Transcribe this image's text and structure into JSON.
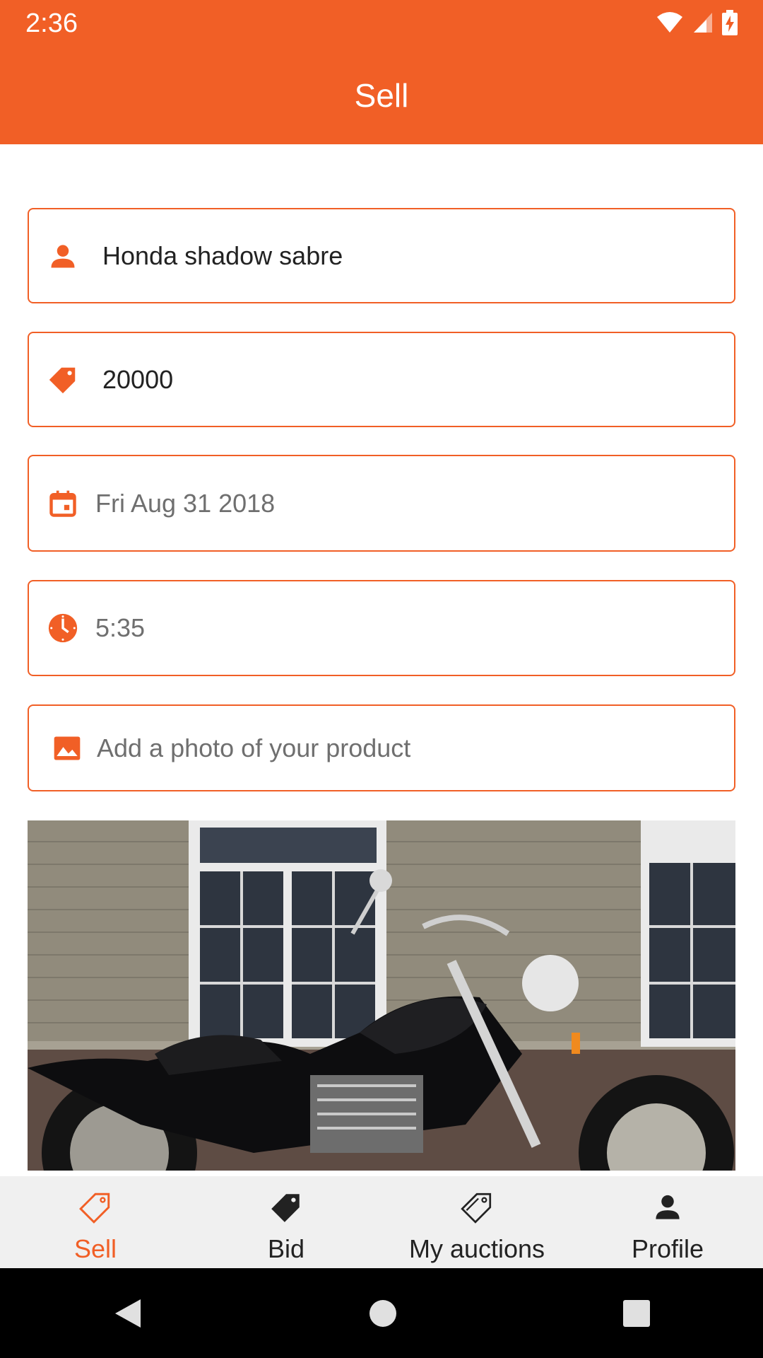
{
  "status_bar": {
    "time": "2:36"
  },
  "app_bar": {
    "title": "Sell"
  },
  "form": {
    "product_name": {
      "value": "Honda shadow sabre",
      "icon": "person-icon"
    },
    "price": {
      "value": "20000",
      "icon": "tag-icon"
    },
    "date": {
      "value": "Fri Aug 31 2018",
      "icon": "calendar-icon"
    },
    "time": {
      "value": "5:35",
      "icon": "clock-icon"
    },
    "photo": {
      "label": "Add a photo of your product",
      "icon": "image-icon"
    }
  },
  "bottom_nav": {
    "items": [
      {
        "label": "Sell",
        "icon": "tag-outline-icon",
        "active": true
      },
      {
        "label": "Bid",
        "icon": "tag-filled-icon",
        "active": false
      },
      {
        "label": "My auctions",
        "icon": "tags-outline-icon",
        "active": false
      },
      {
        "label": "Profile",
        "icon": "person-icon",
        "active": false
      }
    ]
  },
  "colors": {
    "accent": "#f15f26",
    "nav_bg": "#f0f0f0",
    "text": "#222222"
  }
}
